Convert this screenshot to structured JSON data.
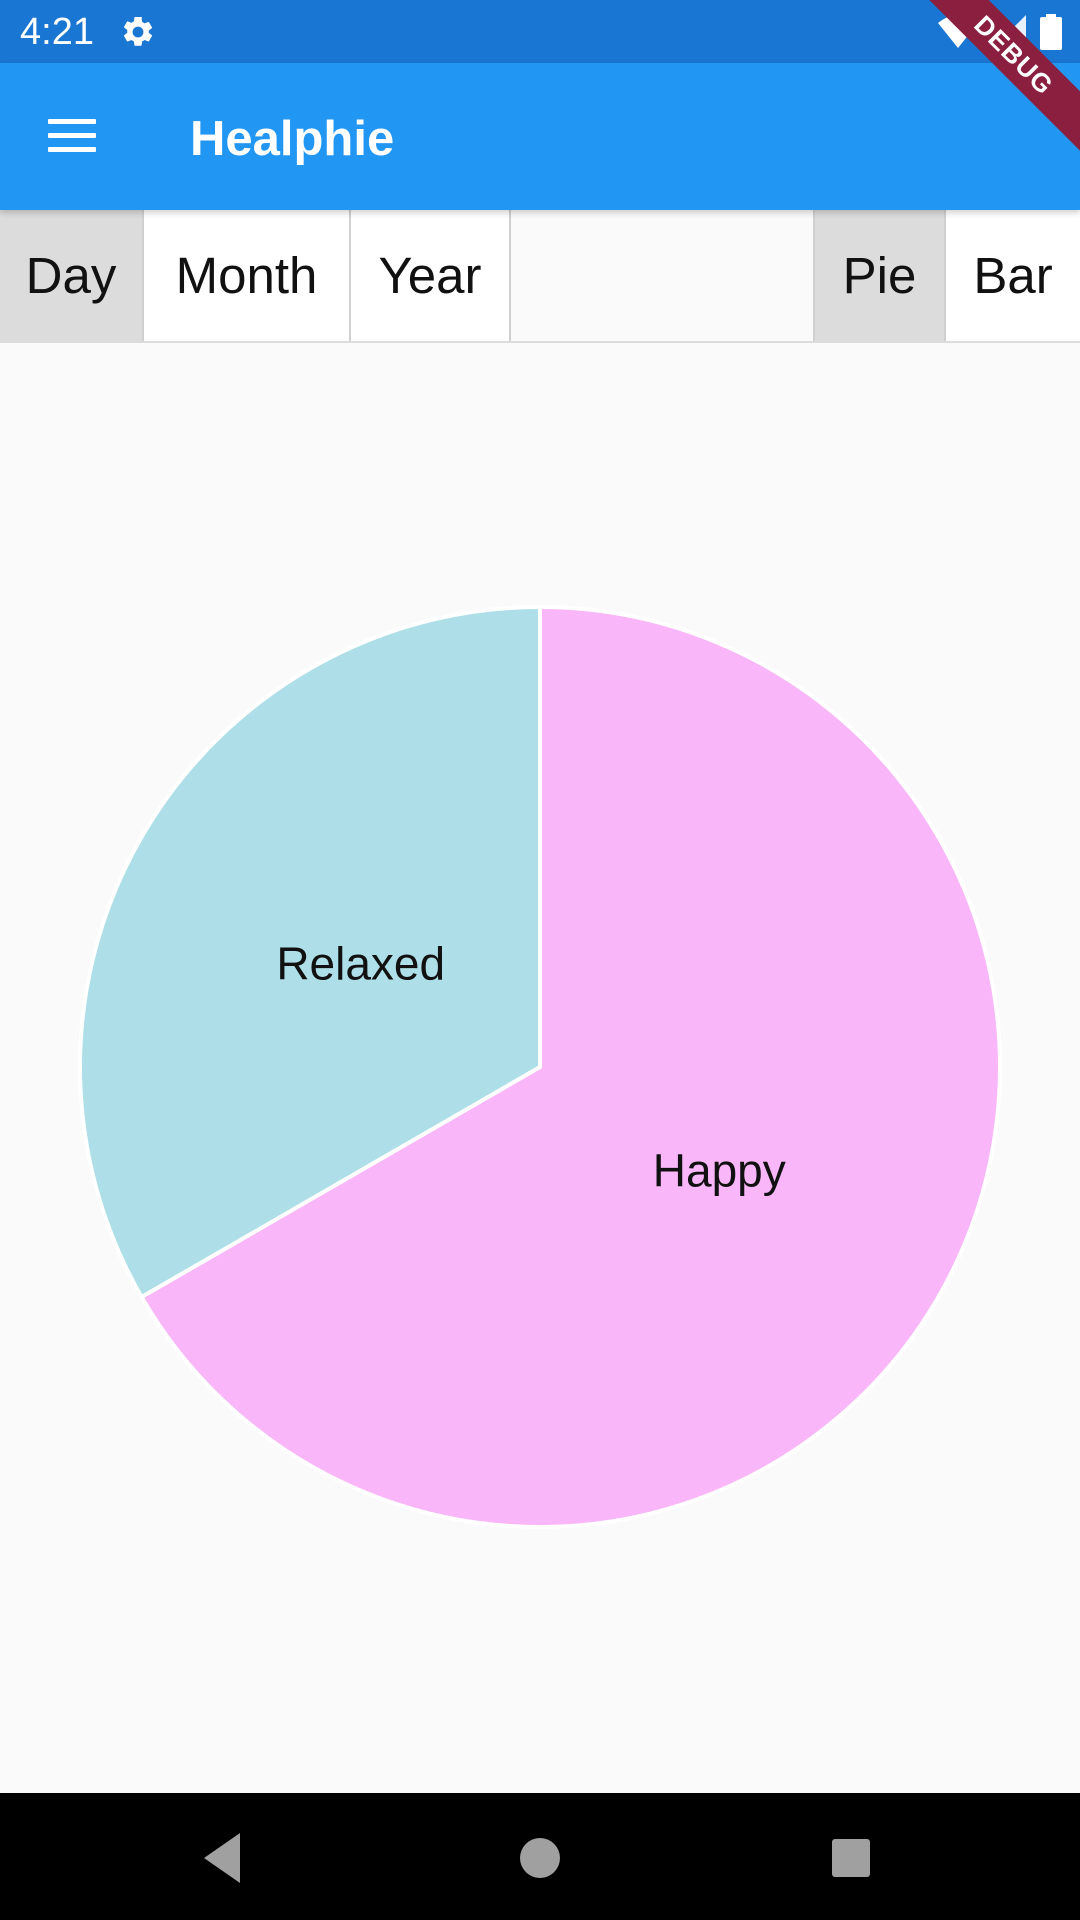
{
  "status_bar": {
    "time": "4:21",
    "icons": [
      "settings-icon",
      "wifi-icon",
      "signal-icon",
      "battery-icon"
    ]
  },
  "debug_banner": "DEBUG",
  "app_bar": {
    "title": "Healphie",
    "menu_icon": "hamburger-menu-icon"
  },
  "period_toggle": {
    "options": [
      "Day",
      "Month",
      "Year"
    ],
    "selected": "Day"
  },
  "chart_toggle": {
    "options": [
      "Pie",
      "Bar"
    ],
    "selected": "Pie"
  },
  "chart_data": {
    "type": "pie",
    "start_angle_deg": -90,
    "slices": [
      {
        "label": "Happy",
        "value": 2,
        "color": "#f9b6f8"
      },
      {
        "label": "Relaxed",
        "value": 1,
        "color": "#aedfe8"
      }
    ],
    "slice_border_color": "#ffffff"
  },
  "colors": {
    "status_bar": "#1976d2",
    "app_bar": "#2196f3",
    "background": "#fafafa",
    "toggle_selected": "#dcdcdc"
  },
  "nav_bar": {
    "buttons": [
      "back-icon",
      "home-icon",
      "recents-icon"
    ]
  }
}
